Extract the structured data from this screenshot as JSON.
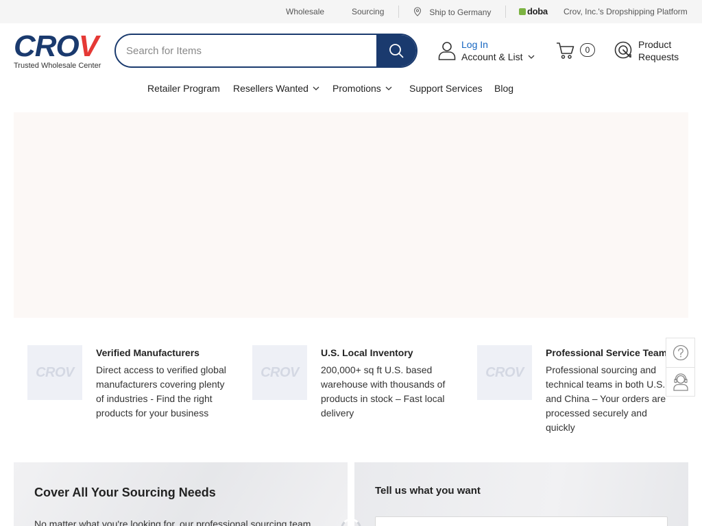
{
  "topbar": {
    "wholesale": "Wholesale",
    "sourcing": "Sourcing",
    "ship_to": "Ship to Germany",
    "doba_logo": "doba",
    "platform": "Crov, Inc.'s Dropshipping Platform",
    "doba_color": "#7cb342"
  },
  "header": {
    "logo_text": "CRO",
    "logo_accent": "V",
    "tagline": "Trusted Wholesale Center",
    "search_placeholder": "Search for Items",
    "login": "Log In",
    "account": "Account & List",
    "cart_count": "0",
    "product_requests_line1": "Product",
    "product_requests_line2": "Requests",
    "brand_color": "#1a3a6e",
    "accent_color": "#e53935"
  },
  "nav": {
    "items": [
      {
        "label": "Retailer Program",
        "dropdown": false
      },
      {
        "label": "Resellers Wanted",
        "dropdown": true
      },
      {
        "label": "Promotions",
        "dropdown": true
      },
      {
        "label": "Support Services",
        "dropdown": false
      },
      {
        "label": "Blog",
        "dropdown": false
      }
    ]
  },
  "features": [
    {
      "placeholder_logo": "CROV",
      "title": "Verified Manufacturers",
      "desc": "Direct access to verified global manufacturers covering plenty of industries - Find the right products for your business"
    },
    {
      "placeholder_logo": "CROV",
      "title": "U.S. Local Inventory",
      "desc": "200,000+ sq ft U.S. based warehouse with thousands of products in stock – Fast local delivery"
    },
    {
      "placeholder_logo": "CROV",
      "title": "Professional Service Team",
      "desc": "Professional sourcing and technical teams in both U.S. and China – Your orders are processed securely and quickly"
    }
  ],
  "sidetools": {
    "help_icon": "question-circle-icon",
    "support_icon": "customer-service-icon"
  },
  "panels": {
    "left_title": "Cover All Your Sourcing Needs",
    "left_text": "No matter what you're looking for, our professional sourcing team",
    "right_title": "Tell us what you want"
  }
}
